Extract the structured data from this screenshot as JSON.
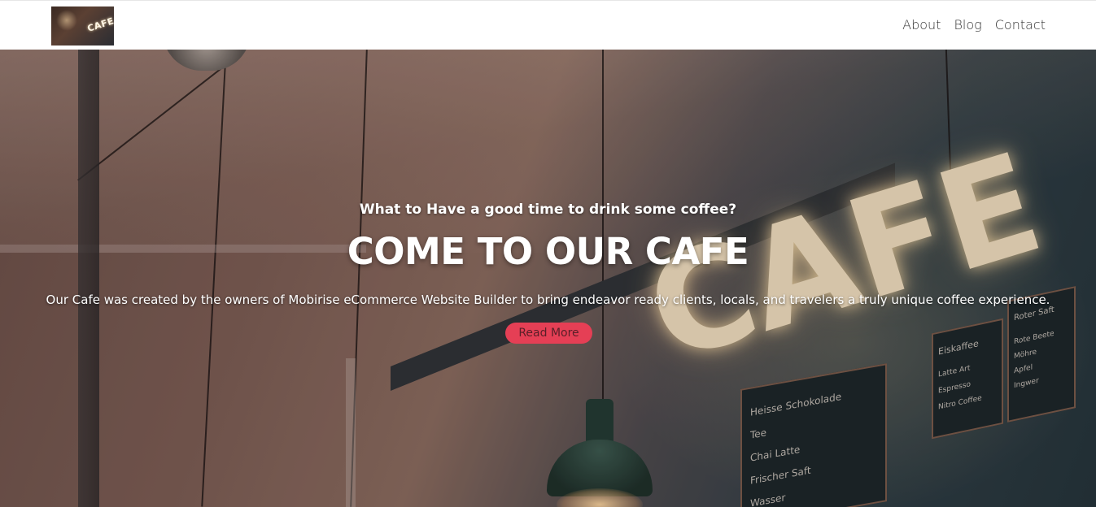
{
  "header": {
    "logo": {
      "alt_text": "CAFE",
      "icon": "cafe-logo-thumbnail"
    },
    "nav": [
      {
        "label": "About"
      },
      {
        "label": "Blog"
      },
      {
        "label": "Contact"
      }
    ]
  },
  "hero": {
    "subtitle": "What to Have a good time to drink some coffee?",
    "title": "COME TO OUR CAFE",
    "description": "Our Cafe was created by the owners of Mobirise eCommerce Website Builder to bring endeavor ready clients, locals, and travelers a truly unique coffee experience.",
    "button_label": "Read More",
    "background": "cafe-interior-photo",
    "sign_text": "CAFE",
    "menu_board_1": [
      "Eiskaffee",
      "Latte Art",
      "Espresso",
      "Nitro Coffee"
    ],
    "menu_board_2": [
      "Heisse Schokolade",
      "Tee",
      "Chai Latte",
      "Frischer Saft",
      "Wasser"
    ],
    "menu_board_3": [
      "Roter Saft",
      "Rote Beete",
      "Möhre",
      "Apfel",
      "Ingwer"
    ]
  },
  "colors": {
    "accent": "#e53f55",
    "nav_text": "#333333",
    "hero_text": "#ffffff"
  }
}
